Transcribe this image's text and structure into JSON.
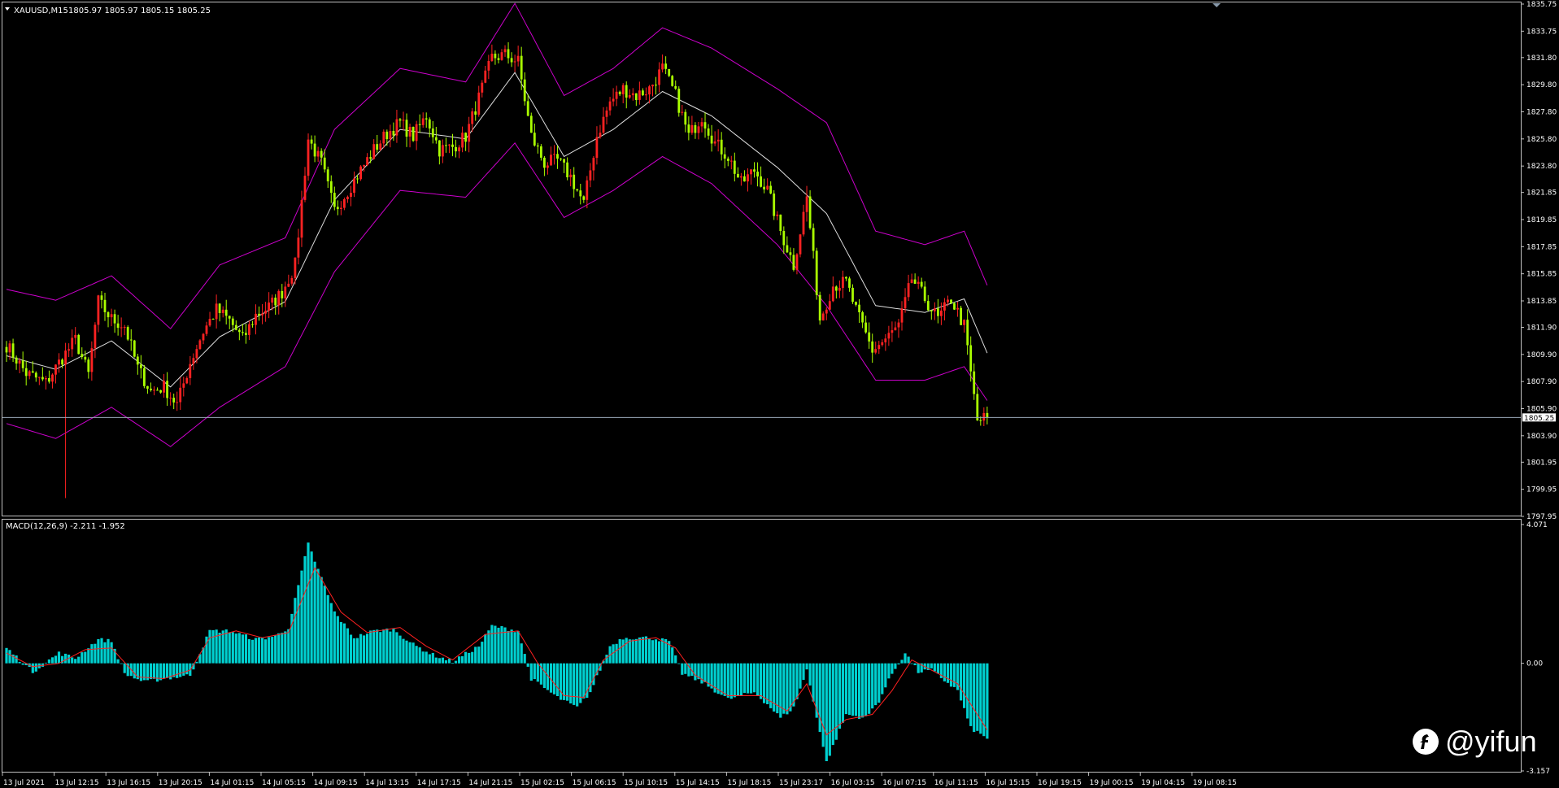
{
  "window": {
    "main_label": "XAUUSD,M15",
    "main_ohlc": "1805.97 1805.97 1805.15 1805.25",
    "macd_label": "MACD(12,26,9) -2.211 -1.952",
    "watermark": "@yifun"
  },
  "colors": {
    "background": "#000000",
    "frame": "#c0c0c0",
    "bull": "#ff2222",
    "bear": "#aaff00",
    "bands": "#cc00cc",
    "middle": "#dddddd",
    "histogram": "#00d0d0",
    "signal": "#ff2020",
    "text": "#ffffff"
  },
  "chart_data": [
    {
      "type": "candlestick",
      "title": "XAUUSD,M15 1805.97 1805.97 1805.15 1805.25",
      "ylim": [
        1797.95,
        1835.75
      ],
      "y_ticks": [
        "1835.75",
        "1833.75",
        "1831.80",
        "1829.80",
        "1827.80",
        "1825.80",
        "1823.80",
        "1821.85",
        "1819.85",
        "1817.85",
        "1815.85",
        "1813.85",
        "1811.90",
        "1809.90",
        "1807.90",
        "1805.90",
        "1803.90",
        "1801.95",
        "1799.95",
        "1797.95"
      ],
      "current_price": "1805.25",
      "x_ticks": [
        "13 Jul 2021",
        "13 Jul 12:15",
        "13 Jul 16:15",
        "13 Jul 20:15",
        "14 Jul 01:15",
        "14 Jul 05:15",
        "14 Jul 09:15",
        "14 Jul 13:15",
        "14 Jul 17:15",
        "14 Jul 21:15",
        "15 Jul 02:15",
        "15 Jul 06:15",
        "15 Jul 10:15",
        "15 Jul 14:15",
        "15 Jul 18:15",
        "15 Jul 23:17",
        "16 Jul 03:15",
        "16 Jul 07:15",
        "16 Jul 11:15",
        "16 Jul 15:15",
        "16 Jul 19:15",
        "19 Jul 00:15",
        "19 Jul 04:15",
        "19 Jul 08:15"
      ],
      "close_anchors": [
        [
          0,
          1810.6
        ],
        [
          6,
          1808.5
        ],
        [
          12,
          1807.8
        ],
        [
          16,
          1809.3
        ],
        [
          21,
          1811.0
        ],
        [
          25,
          1808.4
        ],
        [
          28,
          1813.8
        ],
        [
          32,
          1812.5
        ],
        [
          36,
          1812.0
        ],
        [
          40,
          1808.9
        ],
        [
          44,
          1807.2
        ],
        [
          48,
          1807.5
        ],
        [
          52,
          1806.2
        ],
        [
          56,
          1809.3
        ],
        [
          60,
          1811.6
        ],
        [
          64,
          1813.2
        ],
        [
          68,
          1812.4
        ],
        [
          72,
          1811.0
        ],
        [
          76,
          1812.8
        ],
        [
          80,
          1813.4
        ],
        [
          84,
          1814.5
        ],
        [
          88,
          1816.5
        ],
        [
          92,
          1825.8
        ],
        [
          96,
          1824.0
        ],
        [
          100,
          1820.5
        ],
        [
          104,
          1822.0
        ],
        [
          108,
          1823.5
        ],
        [
          112,
          1825.0
        ],
        [
          116,
          1826.2
        ],
        [
          120,
          1827.0
        ],
        [
          124,
          1826.0
        ],
        [
          128,
          1827.5
        ],
        [
          132,
          1825.0
        ],
        [
          136,
          1825.2
        ],
        [
          140,
          1826.0
        ],
        [
          144,
          1828.8
        ],
        [
          148,
          1831.8
        ],
        [
          152,
          1832.0
        ],
        [
          156,
          1831.5
        ],
        [
          160,
          1826.0
        ],
        [
          164,
          1824.0
        ],
        [
          168,
          1824.2
        ],
        [
          172,
          1823.0
        ],
        [
          176,
          1821.0
        ],
        [
          180,
          1826.0
        ],
        [
          184,
          1828.5
        ],
        [
          188,
          1829.5
        ],
        [
          192,
          1829.0
        ],
        [
          196,
          1829.5
        ],
        [
          200,
          1831.0
        ],
        [
          204,
          1829.0
        ],
        [
          208,
          1826.0
        ],
        [
          212,
          1827.5
        ],
        [
          216,
          1825.5
        ],
        [
          220,
          1824.5
        ],
        [
          224,
          1822.5
        ],
        [
          228,
          1823.5
        ],
        [
          232,
          1822.0
        ],
        [
          236,
          1819.0
        ],
        [
          240,
          1816.5
        ],
        [
          244,
          1821.5
        ],
        [
          248,
          1812.5
        ],
        [
          252,
          1815.0
        ],
        [
          256,
          1815.2
        ],
        [
          260,
          1812.5
        ],
        [
          264,
          1810.2
        ],
        [
          268,
          1811.0
        ],
        [
          272,
          1812.0
        ],
        [
          276,
          1815.5
        ],
        [
          280,
          1814.0
        ],
        [
          284,
          1812.5
        ],
        [
          288,
          1814.0
        ],
        [
          292,
          1812.0
        ],
        [
          296,
          1805.0
        ],
        [
          299,
          1805.25
        ]
      ],
      "bands_upper_anchors": [
        [
          0,
          1814.7
        ],
        [
          15,
          1813.9
        ],
        [
          32,
          1815.7
        ],
        [
          50,
          1811.8
        ],
        [
          65,
          1816.5
        ],
        [
          85,
          1818.5
        ],
        [
          100,
          1826.5
        ],
        [
          120,
          1831.0
        ],
        [
          140,
          1830.0
        ],
        [
          155,
          1835.8
        ],
        [
          170,
          1829.0
        ],
        [
          185,
          1831.0
        ],
        [
          200,
          1834.0
        ],
        [
          215,
          1832.5
        ],
        [
          235,
          1829.5
        ],
        [
          250,
          1827.0
        ],
        [
          265,
          1819.0
        ],
        [
          280,
          1818.0
        ],
        [
          292,
          1819.0
        ],
        [
          299,
          1815.0
        ]
      ],
      "bands_lower_anchors": [
        [
          0,
          1804.8
        ],
        [
          15,
          1803.7
        ],
        [
          32,
          1806.0
        ],
        [
          50,
          1803.1
        ],
        [
          65,
          1806.0
        ],
        [
          85,
          1809.0
        ],
        [
          100,
          1816.0
        ],
        [
          120,
          1822.0
        ],
        [
          140,
          1821.5
        ],
        [
          155,
          1825.5
        ],
        [
          170,
          1820.0
        ],
        [
          185,
          1822.0
        ],
        [
          200,
          1824.5
        ],
        [
          215,
          1822.5
        ],
        [
          235,
          1818.0
        ],
        [
          250,
          1813.5
        ],
        [
          265,
          1808.0
        ],
        [
          280,
          1808.0
        ],
        [
          292,
          1809.0
        ],
        [
          299,
          1806.5
        ]
      ],
      "bands_middle_anchors": [
        [
          0,
          1809.8
        ],
        [
          15,
          1808.8
        ],
        [
          32,
          1810.9
        ],
        [
          50,
          1807.5
        ],
        [
          65,
          1811.2
        ],
        [
          85,
          1813.8
        ],
        [
          100,
          1821.3
        ],
        [
          120,
          1826.5
        ],
        [
          140,
          1825.8
        ],
        [
          155,
          1830.7
        ],
        [
          170,
          1824.5
        ],
        [
          185,
          1826.5
        ],
        [
          200,
          1829.3
        ],
        [
          215,
          1827.5
        ],
        [
          235,
          1823.7
        ],
        [
          250,
          1820.3
        ],
        [
          265,
          1813.5
        ],
        [
          280,
          1813.0
        ],
        [
          292,
          1814.0
        ],
        [
          299,
          1810.0
        ]
      ]
    },
    {
      "type": "bar",
      "title": "MACD(12,26,9) -2.211 -1.952",
      "ylim": [
        -3.157,
        4.071
      ],
      "y_ticks": [
        "4.071",
        "0.00",
        "-3.157"
      ],
      "histogram_anchors": [
        [
          0,
          0.45
        ],
        [
          8,
          -0.25
        ],
        [
          16,
          0.3
        ],
        [
          21,
          0.15
        ],
        [
          28,
          0.7
        ],
        [
          32,
          0.65
        ],
        [
          36,
          -0.3
        ],
        [
          42,
          -0.55
        ],
        [
          48,
          -0.45
        ],
        [
          56,
          -0.35
        ],
        [
          62,
          0.95
        ],
        [
          68,
          0.95
        ],
        [
          76,
          0.7
        ],
        [
          82,
          0.8
        ],
        [
          86,
          1.05
        ],
        [
          92,
          3.5
        ],
        [
          100,
          1.5
        ],
        [
          106,
          0.75
        ],
        [
          112,
          0.95
        ],
        [
          118,
          1.0
        ],
        [
          124,
          0.55
        ],
        [
          130,
          0.25
        ],
        [
          136,
          0.05
        ],
        [
          144,
          0.5
        ],
        [
          148,
          1.1
        ],
        [
          156,
          0.95
        ],
        [
          160,
          -0.45
        ],
        [
          168,
          -1.0
        ],
        [
          174,
          -1.3
        ],
        [
          178,
          -0.85
        ],
        [
          184,
          0.5
        ],
        [
          188,
          0.75
        ],
        [
          196,
          0.75
        ],
        [
          202,
          0.65
        ],
        [
          206,
          -0.3
        ],
        [
          212,
          -0.55
        ],
        [
          220,
          -1.05
        ],
        [
          228,
          -0.85
        ],
        [
          232,
          -1.2
        ],
        [
          236,
          -1.6
        ],
        [
          240,
          -1.3
        ],
        [
          244,
          -0.2
        ],
        [
          250,
          -2.9
        ],
        [
          256,
          -1.5
        ],
        [
          262,
          -1.6
        ],
        [
          266,
          -1.1
        ],
        [
          270,
          -0.3
        ],
        [
          274,
          0.3
        ],
        [
          278,
          -0.25
        ],
        [
          282,
          -0.2
        ],
        [
          290,
          -0.8
        ],
        [
          294,
          -1.9
        ],
        [
          299,
          -2.211
        ]
      ],
      "signal_anchors": [
        [
          0,
          0.3
        ],
        [
          8,
          -0.1
        ],
        [
          16,
          0.0
        ],
        [
          24,
          0.4
        ],
        [
          32,
          0.45
        ],
        [
          40,
          -0.4
        ],
        [
          48,
          -0.45
        ],
        [
          56,
          -0.2
        ],
        [
          62,
          0.75
        ],
        [
          70,
          0.95
        ],
        [
          78,
          0.75
        ],
        [
          86,
          0.9
        ],
        [
          94,
          2.8
        ],
        [
          102,
          1.5
        ],
        [
          110,
          0.9
        ],
        [
          120,
          1.05
        ],
        [
          128,
          0.5
        ],
        [
          136,
          0.1
        ],
        [
          146,
          0.85
        ],
        [
          156,
          0.95
        ],
        [
          162,
          0.0
        ],
        [
          170,
          -0.95
        ],
        [
          176,
          -1.0
        ],
        [
          182,
          0.1
        ],
        [
          190,
          0.65
        ],
        [
          198,
          0.75
        ],
        [
          204,
          0.45
        ],
        [
          210,
          -0.35
        ],
        [
          220,
          -0.95
        ],
        [
          230,
          -0.95
        ],
        [
          238,
          -1.4
        ],
        [
          244,
          -0.6
        ],
        [
          250,
          -2.1
        ],
        [
          256,
          -1.65
        ],
        [
          264,
          -1.5
        ],
        [
          270,
          -0.8
        ],
        [
          276,
          0.1
        ],
        [
          282,
          -0.2
        ],
        [
          290,
          -0.6
        ],
        [
          299,
          -1.952
        ]
      ]
    }
  ]
}
